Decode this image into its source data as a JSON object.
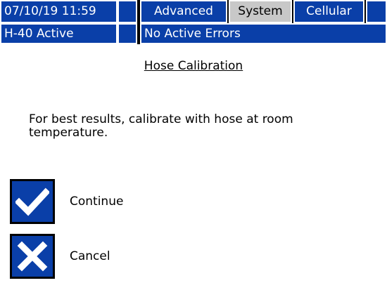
{
  "status": {
    "datetime": "07/10/19 11:59",
    "mode": "H-40 Active",
    "errors": "No Active Errors"
  },
  "tabs": [
    {
      "label": "Advanced",
      "selected": false
    },
    {
      "label": "System",
      "selected": true
    },
    {
      "label": "Cellular",
      "selected": false
    }
  ],
  "screen": {
    "title": "Hose Calibration",
    "message": "For best results, calibrate with hose at room temperature."
  },
  "actions": {
    "continue_label": "Continue",
    "continue_icon": "checkmark-icon",
    "cancel_label": "Cancel",
    "cancel_icon": "x-icon"
  },
  "colors": {
    "accent_blue": "#0a3fa8",
    "selected_tab": "#c8c8c8"
  }
}
